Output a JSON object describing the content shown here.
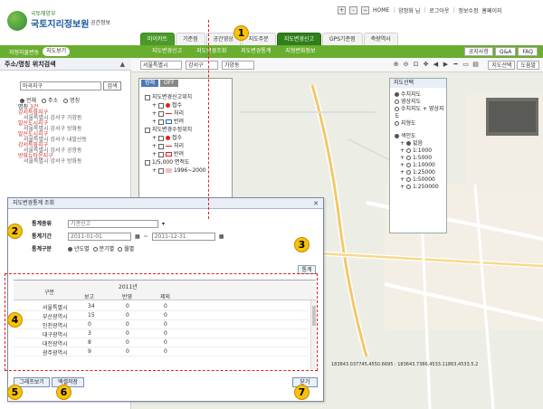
{
  "header": {
    "logo_sub": "국토해양부",
    "logo_main": "국토지리정보원",
    "logo_tag": "공간정보",
    "util_items": [
      "HOME",
      "양정화 님",
      "로그아웃",
      "정보수정",
      "홈페이지"
    ],
    "top_tabs": [
      "마이카트",
      "기준점",
      "공간영상",
      "지도주문",
      "지도변경신고",
      "GPS기준점",
      "측량역사"
    ]
  },
  "subnav": {
    "left_label": "지형지물변동",
    "left_button": "지도보기",
    "items": [
      "지도변경신고",
      "지도변경조회",
      "지도변경통계",
      "지형변화정보"
    ],
    "right_buttons": [
      "공지사항",
      "Q&A",
      "FAQ"
    ]
  },
  "left_panel": {
    "title": "주소/명칭 위치검색",
    "search_value": "마곡지구",
    "search_button": "검색",
    "radios": [
      "전체",
      "주소",
      "명칭"
    ],
    "result_label": "명칭",
    "result_count": "3건",
    "results": [
      {
        "name": "강서특화지구",
        "addr": "서울특별시 강서구 가양동"
      },
      {
        "name": "발산도시지구",
        "addr": "서울특별시 강서구 방화동"
      },
      {
        "name": "발산도시지구",
        "addr": "서울특별시 강서구 내발산동"
      },
      {
        "name": "강서특화지구",
        "addr": "서울특별시 강서구 공항동"
      },
      {
        "name": "방화뉴타운지구",
        "addr": "서울특별시 강서구 방화동"
      }
    ]
  },
  "map_toolbar": {
    "selects": [
      "서울특별시",
      "강서구",
      "가양동"
    ],
    "buttons": [
      "지도선택",
      "도움말"
    ]
  },
  "layer_panel": {
    "tabs": [
      "범례",
      "OFF"
    ],
    "groups": [
      {
        "title": "지도변경신고위치",
        "items": [
          "접수",
          "처리",
          "반려"
        ]
      },
      {
        "title": "지도변경수정위치",
        "items": [
          "접수",
          "처리",
          "반려"
        ]
      },
      {
        "title": "1/5,000 면적도",
        "items": [
          "1996~2000"
        ]
      }
    ]
  },
  "basemap": {
    "title": "지도선택",
    "options": [
      "수치지도",
      "영상지도",
      "수치지도 + 영상지도",
      "지형도"
    ],
    "index_label": "색인도",
    "index_options": [
      "없음",
      "1:1000",
      "1:5000",
      "1:10000",
      "1:25000",
      "1:50000",
      "1:250000"
    ]
  },
  "dialog": {
    "title": "지도변경통계 조회",
    "labels": {
      "type": "통계종류",
      "period": "통계기간",
      "unit": "통계구분"
    },
    "type_value": "기관신고",
    "date_from": "2011-01-01",
    "date_to": "2011-12-31",
    "units": [
      "년도별",
      "분기별",
      "월별"
    ],
    "search_button": "통계",
    "table": {
      "year": "2011년",
      "col_region": "구분",
      "cols": [
        "보고",
        "반영",
        "제외"
      ],
      "rows": [
        {
          "region": "서울특별시",
          "report": "34",
          "applied": "0",
          "excluded": "0"
        },
        {
          "region": "부산광역시",
          "report": "15",
          "applied": "0",
          "excluded": "0"
        },
        {
          "region": "인천광역시",
          "report": "0",
          "applied": "0",
          "excluded": "0"
        },
        {
          "region": "대구광역시",
          "report": "3",
          "applied": "0",
          "excluded": "0"
        },
        {
          "region": "대전광역시",
          "report": "8",
          "applied": "0",
          "excluded": "0"
        },
        {
          "region": "광주광역시",
          "report": "9",
          "applied": "0",
          "excluded": "0"
        }
      ]
    },
    "graph_button": "그래프보기",
    "excel_button": "엑셀저장",
    "close_button": "닫기"
  },
  "map_coords": "183843.037745,4550.6695 : 183643.7386,4533.11863,4533.5.2",
  "callouts": [
    "1",
    "2",
    "3",
    "4",
    "5",
    "6",
    "7"
  ],
  "colors": {
    "green": "#6aae2f",
    "marker": "#f6c30a",
    "dash": "#e02020"
  }
}
